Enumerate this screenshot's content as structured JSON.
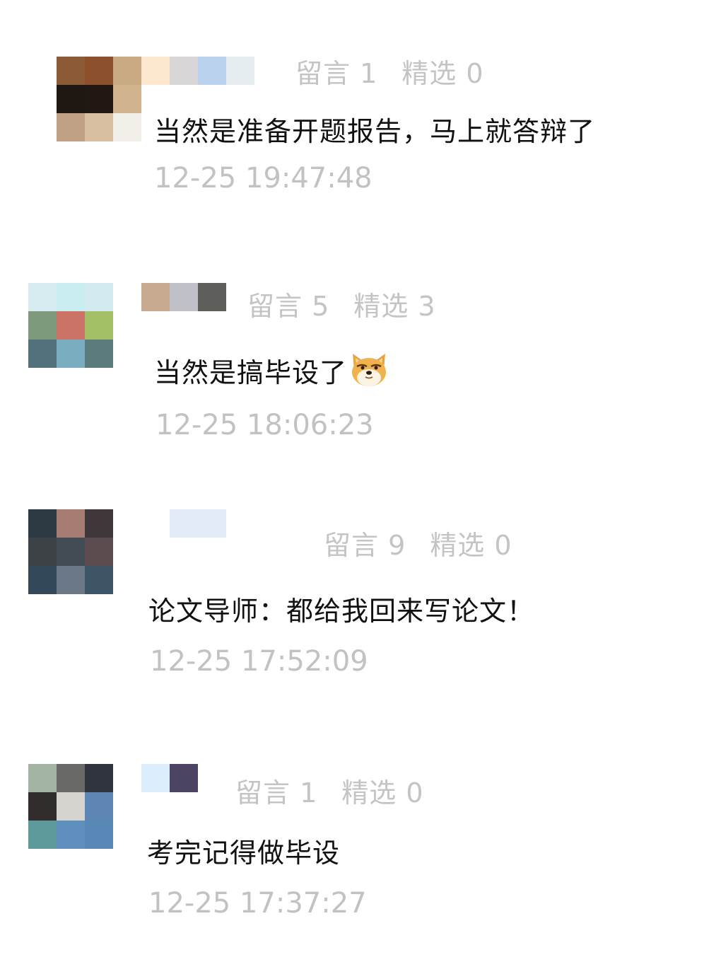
{
  "comments": [
    {
      "avatar_colors": [
        "#8a5a37",
        "#8b4f2c",
        "#c9aa82",
        "#1f1812",
        "#211813",
        "#d1b38e",
        "#bfa084",
        "#d9bfa1",
        "#f3efe9"
      ],
      "name_colors": [
        "#fde8cf",
        "#d8d6d6",
        "#bad2ee",
        "#e6eef2"
      ],
      "stats": {
        "messages_label": "留言",
        "messages_count": "1",
        "picks_label": "精选",
        "picks_count": "0"
      },
      "text": "当然是准备开题报告，马上就答辩了",
      "time": "12-25 19:47:48"
    },
    {
      "avatar_colors": [
        "#d6ecf1",
        "#c9edf1",
        "#d3ecf2",
        "#7d9b7c",
        "#cc7267",
        "#a4c168",
        "#52707c",
        "#79acbf",
        "#5b7b7d"
      ],
      "name_colors": [
        "#c7aa90",
        "#c0c0c8",
        "#5d5d5a"
      ],
      "stats": {
        "messages_label": "留言",
        "messages_count": "5",
        "picks_label": "精选",
        "picks_count": "3"
      },
      "text": "当然是搞毕设了",
      "emoji": "doge-emoji",
      "time": "12-25 18:06:23"
    },
    {
      "avatar_colors": [
        "#2d3a44",
        "#a67c73",
        "#3f3739",
        "#3c4246",
        "#434d55",
        "#5c4c50",
        "#33495a",
        "#6b7a86",
        "#3d5566"
      ],
      "name_colors": [
        "#e2ecf8"
      ],
      "stats": {
        "messages_label": "留言",
        "messages_count": "9",
        "picks_label": "精选",
        "picks_count": "0"
      },
      "text": "论文导师：都给我回来写论文！",
      "time": "12-25 17:52:09"
    },
    {
      "avatar_colors": [
        "#a3b4a4",
        "#696a68",
        "#31353e",
        "#2f2c2b",
        "#d6d4cf",
        "#5d85b4",
        "#5e9a9b",
        "#5f8fbd",
        "#5a88b6"
      ],
      "name_colors": [
        "#dcedfb",
        "#4d4463"
      ],
      "stats": {
        "messages_label": "留言",
        "messages_count": "1",
        "picks_label": "精选",
        "picks_count": "0"
      },
      "text": "考完记得做毕设",
      "time": "12-25 17:37:27"
    }
  ]
}
